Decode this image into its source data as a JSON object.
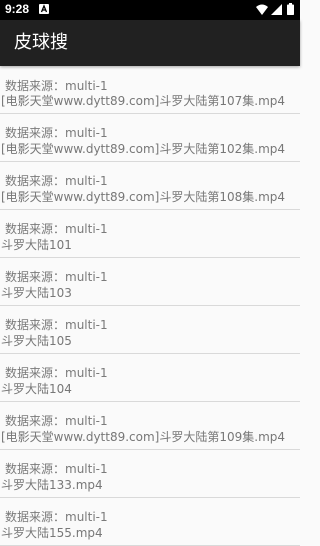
{
  "status_bar": {
    "time": "9:28",
    "icons": [
      "a-notification-icon",
      "wifi-icon",
      "signal-icon",
      "battery-icon"
    ]
  },
  "app_bar": {
    "title": "皮球搜"
  },
  "results": [
    {
      "source": "数据来源：multi-1",
      "name": "[电影天堂www.dytt89.com]斗罗大陆第107集.mp4"
    },
    {
      "source": "数据来源：multi-1",
      "name": "[电影天堂www.dytt89.com]斗罗大陆第102集.mp4"
    },
    {
      "source": "数据来源：multi-1",
      "name": "[电影天堂www.dytt89.com]斗罗大陆第108集.mp4"
    },
    {
      "source": "数据来源：multi-1",
      "name": "斗罗大陆101"
    },
    {
      "source": "数据来源：multi-1",
      "name": "斗罗大陆103"
    },
    {
      "source": "数据来源：multi-1",
      "name": "斗罗大陆105"
    },
    {
      "source": "数据来源：multi-1",
      "name": "斗罗大陆104"
    },
    {
      "source": "数据来源：multi-1",
      "name": "[电影天堂www.dytt89.com]斗罗大陆第109集.mp4"
    },
    {
      "source": "数据来源：multi-1",
      "name": "斗罗大陆133.mp4"
    },
    {
      "source": "数据来源：multi-1",
      "name": "斗罗大陆155.mp4"
    }
  ],
  "colors": {
    "status_bar": "#000000",
    "app_bar": "#212121",
    "background": "#fafafa",
    "text": "#777777",
    "divider": "#d9d9d9"
  }
}
